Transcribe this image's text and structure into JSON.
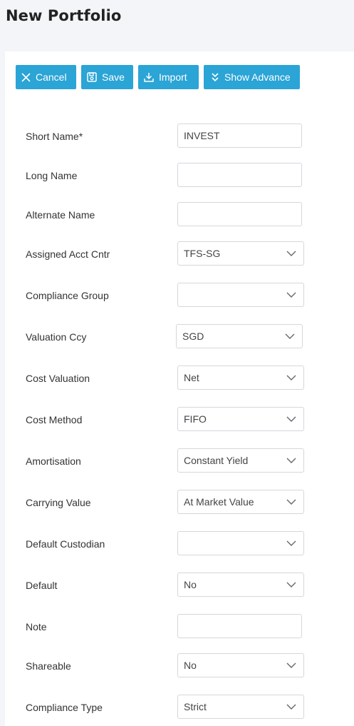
{
  "page": {
    "title": "New Portfolio"
  },
  "toolbar": {
    "cancel_label": "Cancel",
    "save_label": "Save",
    "import_label": "Import",
    "advance_label": "Show Advance"
  },
  "form": {
    "short_name": {
      "label": "Short Name*",
      "value": "INVEST"
    },
    "long_name": {
      "label": "Long Name",
      "value": ""
    },
    "alternate_name": {
      "label": "Alternate Name",
      "value": ""
    },
    "assigned_acct_cntr": {
      "label": "Assigned Acct Cntr",
      "value": "TFS-SG"
    },
    "compliance_group": {
      "label": "Compliance Group",
      "value": ""
    },
    "valuation_ccy": {
      "label": "Valuation Ccy",
      "value": "SGD"
    },
    "cost_valuation": {
      "label": "Cost Valuation",
      "value": "Net"
    },
    "cost_method": {
      "label": "Cost Method",
      "value": "FIFO"
    },
    "amortisation": {
      "label": "Amortisation",
      "value": "Constant Yield"
    },
    "carrying_value": {
      "label": "Carrying Value",
      "value": "At Market Value"
    },
    "default_custodian": {
      "label": "Default Custodian",
      "value": ""
    },
    "default": {
      "label": "Default",
      "value": "No"
    },
    "note": {
      "label": "Note",
      "value": ""
    },
    "shareable": {
      "label": "Shareable",
      "value": "No"
    },
    "compliance_type": {
      "label": "Compliance Type",
      "value": "Strict"
    }
  },
  "colors": {
    "button_bg": "#2ba4d6",
    "page_bg": "#f3f5f8",
    "panel_bg": "#ffffff"
  }
}
